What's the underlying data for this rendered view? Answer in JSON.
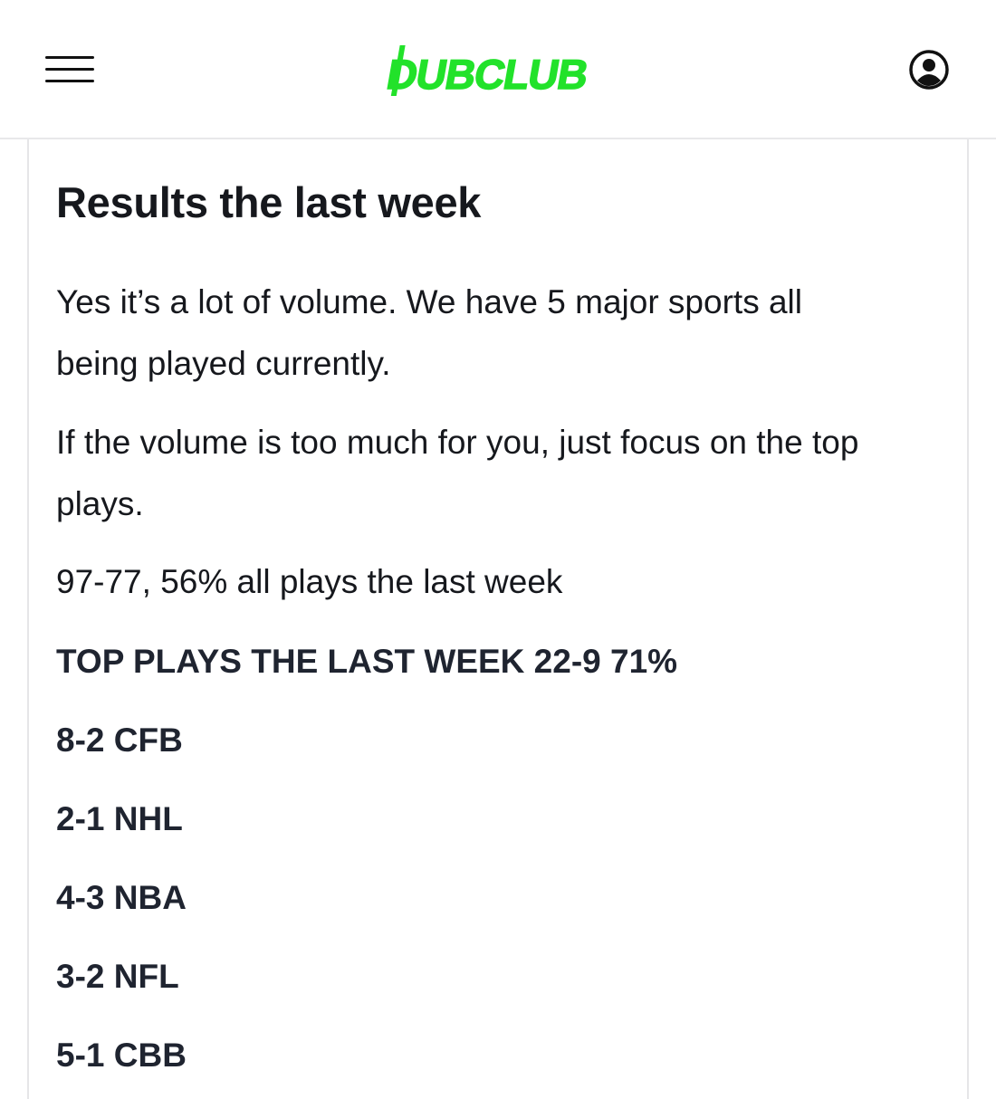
{
  "header": {
    "menu_icon": "hamburger-menu-icon",
    "logo_text": "DUBCLUB",
    "brand_color": "#22e22a",
    "profile_icon": "user-circle-icon"
  },
  "article": {
    "title": "Results the last week",
    "paragraphs": [
      "Yes it’s a lot of volume. We have 5 major sports all being played currently.",
      "If the volume is too much for you, just focus on the top plays.",
      "97-77, 56% all plays the last week"
    ],
    "top_plays_heading": "TOP PLAYS THE LAST WEEK 22-9 71%",
    "sport_results": [
      "8-2 CFB",
      "2-1 NHL",
      "4-3 NBA",
      "3-2 NFL",
      "5-1 CBB"
    ]
  }
}
